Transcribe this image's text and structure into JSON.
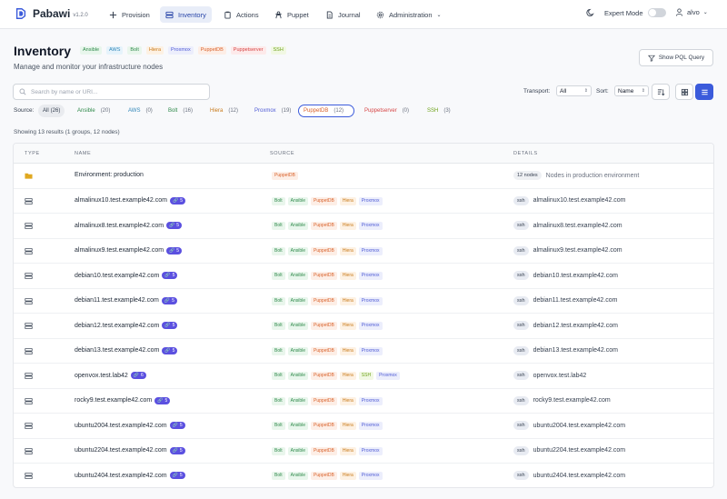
{
  "app": {
    "name": "Pabawi",
    "version": "v1.2.0"
  },
  "nav": [
    {
      "label": "Provision",
      "icon": "plus-icon"
    },
    {
      "label": "Inventory",
      "icon": "server-icon",
      "active": true
    },
    {
      "label": "Actions",
      "icon": "clipboard-icon"
    },
    {
      "label": "Puppet",
      "icon": "puppet-icon"
    },
    {
      "label": "Journal",
      "icon": "document-icon"
    },
    {
      "label": "Administration",
      "icon": "gear-icon"
    }
  ],
  "header_right": {
    "expert_mode": "Expert Mode",
    "user": "alvo"
  },
  "page": {
    "title": "Inventory",
    "subtitle": "Manage and monitor your infrastructure nodes",
    "tags": [
      "Ansible",
      "AWS",
      "Bolt",
      "Hiera",
      "Proxmox",
      "PuppetDB",
      "Puppetserver",
      "SSH"
    ],
    "pql_button": "Show PQL Query"
  },
  "search": {
    "placeholder": "Search by name or URI..."
  },
  "controls": {
    "transport_label": "Transport:",
    "transport_value": "All",
    "sort_label": "Sort:",
    "sort_value": "Name"
  },
  "source_filter": {
    "label": "Source:",
    "chips": [
      {
        "name": "All",
        "count": "(26)"
      },
      {
        "name": "Ansible",
        "count": "(20)"
      },
      {
        "name": "AWS",
        "count": "(0)"
      },
      {
        "name": "Bolt",
        "count": "(16)"
      },
      {
        "name": "Hiera",
        "count": "(12)"
      },
      {
        "name": "Proxmox",
        "count": "(19)"
      },
      {
        "name": "PuppetDB",
        "count": "(12)",
        "selected": true
      },
      {
        "name": "Puppetserver",
        "count": "(0)"
      },
      {
        "name": "SSH",
        "count": "(3)"
      }
    ]
  },
  "results_summary": "Showing 13 results (1 groups, 12 nodes)",
  "table": {
    "headers": [
      "TYPE",
      "NAME",
      "SOURCE",
      "DETAILS"
    ],
    "rows": [
      {
        "type": "group",
        "name": "Environment: production",
        "link": "",
        "sources": [
          "PuppetDB"
        ],
        "pill": "12 nodes",
        "detail": "Nodes in production environment"
      },
      {
        "type": "node",
        "name": "almalinux10.test.example42.com",
        "link": "5",
        "sources": [
          "Bolt",
          "Ansible",
          "PuppetDB",
          "Hiera",
          "Proxmox"
        ],
        "pill": "ssh",
        "detail": "almalinux10.test.example42.com"
      },
      {
        "type": "node",
        "name": "almalinux8.test.example42.com",
        "link": "5",
        "sources": [
          "Bolt",
          "Ansible",
          "PuppetDB",
          "Hiera",
          "Proxmox"
        ],
        "pill": "ssh",
        "detail": "almalinux8.test.example42.com"
      },
      {
        "type": "node",
        "name": "almalinux9.test.example42.com",
        "link": "5",
        "sources": [
          "Bolt",
          "Ansible",
          "PuppetDB",
          "Hiera",
          "Proxmox"
        ],
        "pill": "ssh",
        "detail": "almalinux9.test.example42.com"
      },
      {
        "type": "node",
        "name": "debian10.test.example42.com",
        "link": "5",
        "sources": [
          "Bolt",
          "Ansible",
          "PuppetDB",
          "Hiera",
          "Proxmox"
        ],
        "pill": "ssh",
        "detail": "debian10.test.example42.com"
      },
      {
        "type": "node",
        "name": "debian11.test.example42.com",
        "link": "5",
        "sources": [
          "Bolt",
          "Ansible",
          "PuppetDB",
          "Hiera",
          "Proxmox"
        ],
        "pill": "ssh",
        "detail": "debian11.test.example42.com"
      },
      {
        "type": "node",
        "name": "debian12.test.example42.com",
        "link": "5",
        "sources": [
          "Bolt",
          "Ansible",
          "PuppetDB",
          "Hiera",
          "Proxmox"
        ],
        "pill": "ssh",
        "detail": "debian12.test.example42.com"
      },
      {
        "type": "node",
        "name": "debian13.test.example42.com",
        "link": "5",
        "sources": [
          "Bolt",
          "Ansible",
          "PuppetDB",
          "Hiera",
          "Proxmox"
        ],
        "pill": "ssh",
        "detail": "debian13.test.example42.com"
      },
      {
        "type": "node",
        "name": "openvox.test.lab42",
        "link": "6",
        "sources": [
          "Bolt",
          "Ansible",
          "PuppetDB",
          "Hiera",
          "SSH",
          "Proxmox"
        ],
        "pill": "ssh",
        "detail": "openvox.test.lab42"
      },
      {
        "type": "node",
        "name": "rocky9.test.example42.com",
        "link": "5",
        "sources": [
          "Bolt",
          "Ansible",
          "PuppetDB",
          "Hiera",
          "Proxmox"
        ],
        "pill": "ssh",
        "detail": "rocky9.test.example42.com"
      },
      {
        "type": "node",
        "name": "ubuntu2004.test.example42.com",
        "link": "5",
        "sources": [
          "Bolt",
          "Ansible",
          "PuppetDB",
          "Hiera",
          "Proxmox"
        ],
        "pill": "ssh",
        "detail": "ubuntu2004.test.example42.com"
      },
      {
        "type": "node",
        "name": "ubuntu2204.test.example42.com",
        "link": "5",
        "sources": [
          "Bolt",
          "Ansible",
          "PuppetDB",
          "Hiera",
          "Proxmox"
        ],
        "pill": "ssh",
        "detail": "ubuntu2204.test.example42.com"
      },
      {
        "type": "node",
        "name": "ubuntu2404.test.example42.com",
        "link": "5",
        "sources": [
          "Bolt",
          "Ansible",
          "PuppetDB",
          "Hiera",
          "Proxmox"
        ],
        "pill": "ssh",
        "detail": "ubuntu2404.test.example42.com"
      }
    ]
  },
  "colors": {
    "accent": "#3b5bdb",
    "link_badge": "#5b50e0",
    "folder": "#e0a820"
  }
}
